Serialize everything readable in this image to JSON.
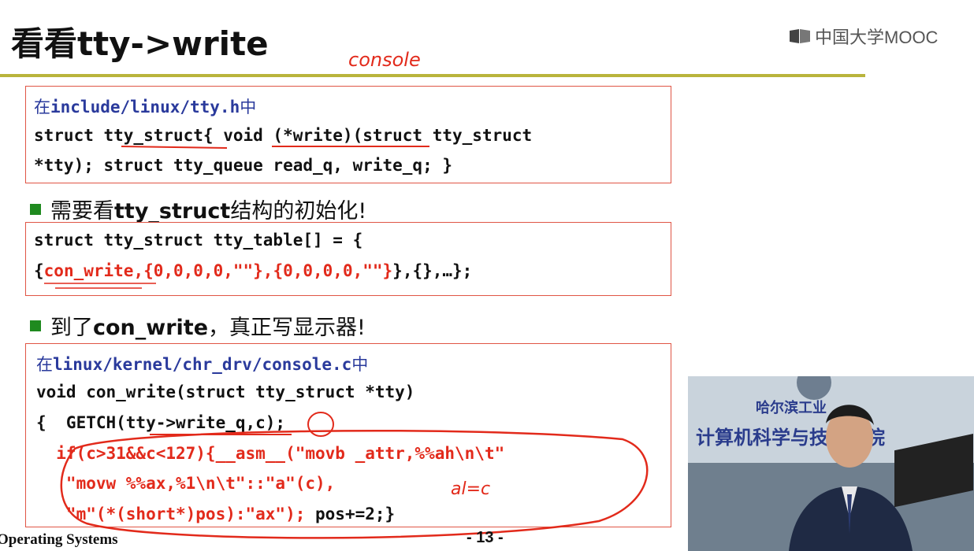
{
  "slide": {
    "title": "看看tty->write",
    "logo_text": "中国大学MOOC"
  },
  "box1": {
    "line1_prefix": "在",
    "line1_path": "include/linux/tty.h",
    "line1_suffix": "中",
    "line2": "struct tty_struct{ void (*write)(struct tty_struct",
    "line3": "*tty); struct tty_queue read_q, write_q; }"
  },
  "bullet1": {
    "prefix": "需要看",
    "bold": "tty_struct",
    "suffix": "结构的初始化!"
  },
  "box2": {
    "line1": "struct tty_struct tty_table[] = {",
    "line2_open": "{",
    "line2_red": "con_write,{0,0,0,0,\"\"},{0,0,0,0,\"\"}",
    "line2_close": "},{},…};"
  },
  "bullet2": {
    "prefix": "到了",
    "bold": "con_write",
    "suffix": "，真正写显示器!"
  },
  "box3": {
    "line1_prefix": "在",
    "line1_path": "linux/kernel/chr_drv/console.c",
    "line1_suffix": "中",
    "line2": "void con_write(struct tty_struct *tty)",
    "line3": "{  GETCH(tty->write_q,c);",
    "line4": "  if(c>31&&c<127){__asm__(\"movb _attr,%%ah\\n\\t\"",
    "line5": "   \"movw %%ax,%1\\n\\t\"::\"a\"(c),",
    "line6_red": "   \"m\"(*(short*)pos):\"ax\");",
    "line6_black": " pos+=2;}"
  },
  "handwriting": {
    "note1": "console",
    "note2": "al=c"
  },
  "footer": {
    "course": "Operating Systems",
    "page": "- 13 -"
  },
  "video": {
    "banner_top": "哈尔滨工业",
    "banner_main": "计算机科学与技术学院"
  }
}
